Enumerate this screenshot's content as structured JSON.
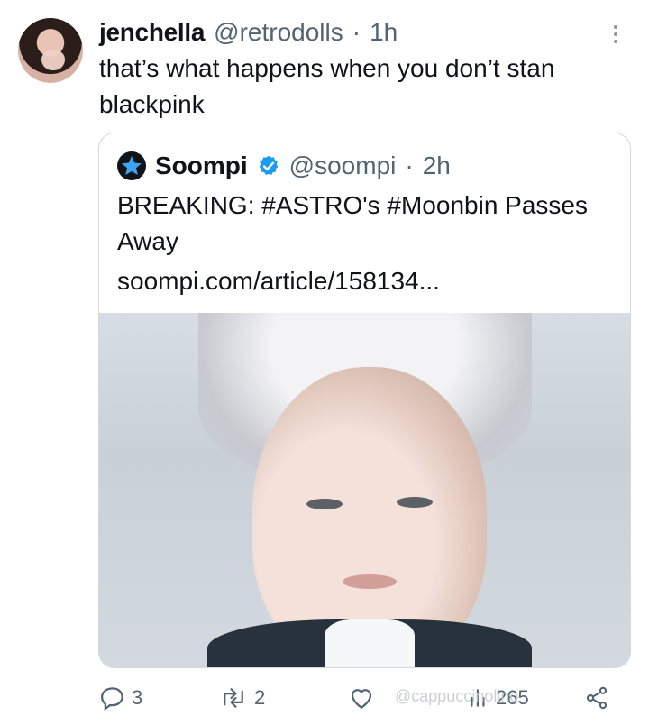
{
  "tweet": {
    "display_name": "jenchella",
    "handle": "@retrodolls",
    "separator": "·",
    "time": "1h",
    "text": "that’s what happens when you don’t stan blackpink"
  },
  "quote": {
    "display_name": "Soompi",
    "handle": "@soompi",
    "separator": "·",
    "time": "2h",
    "text": "BREAKING: #ASTRO's #Moonbin Passes Away",
    "link": "soompi.com/article/158134..."
  },
  "actions": {
    "reply_count": "3",
    "retweet_count": "2",
    "views_count": "265"
  },
  "watermark": "@cappuccinolino",
  "colors": {
    "text": "#0f1419",
    "muted": "#536471",
    "border": "#cfd9de",
    "verified": "#1d9bf0",
    "soompi_star": "#3ea3f1"
  },
  "icons": {
    "reply": "speech-bubble-icon",
    "retweet": "retweet-arrows-icon",
    "like": "heart-icon",
    "views": "bar-chart-icon",
    "share": "share-nodes-icon",
    "more": "vertical-dots-icon",
    "verified": "verified-badge-icon"
  }
}
